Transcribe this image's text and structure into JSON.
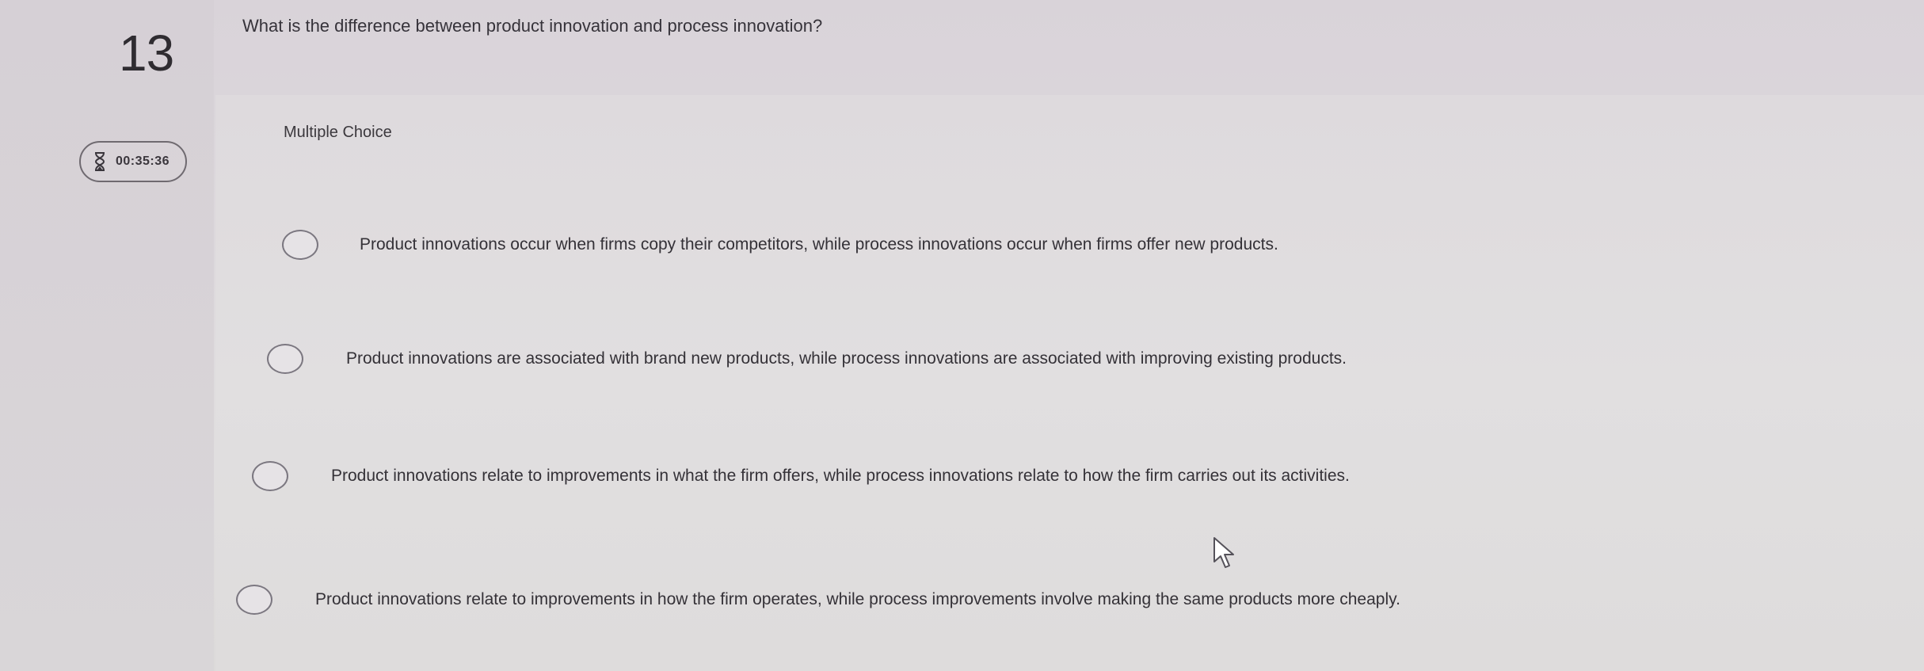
{
  "question": {
    "number": "13",
    "text": "What is the difference between product innovation and process innovation?",
    "type_label": "Multiple Choice"
  },
  "timer": {
    "icon": "hourglass-icon",
    "value": "00:35:36"
  },
  "options": [
    {
      "label": "Product innovations occur when firms copy their competitors, while process innovations occur when firms offer new products."
    },
    {
      "label": "Product innovations are associated with brand new products, while process innovations are associated with improving existing products."
    },
    {
      "label": "Product innovations relate to improvements in what the firm offers, while process innovations relate to how the firm carries out its activities."
    },
    {
      "label": "Product innovations relate to improvements in how the firm operates, while process improvements involve making the same products more cheaply."
    }
  ],
  "colors": {
    "background": "#dcd8dc",
    "text": "#343137",
    "radio_border": "#7b7780"
  }
}
